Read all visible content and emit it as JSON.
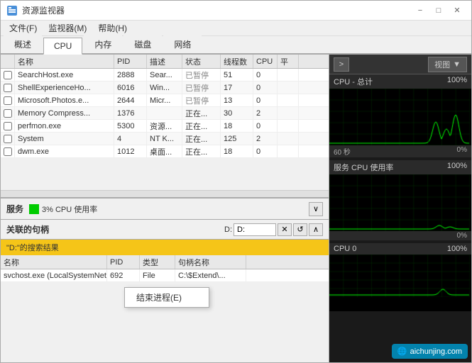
{
  "window": {
    "title": "资源监视器",
    "icon": "monitor-icon"
  },
  "menu": {
    "items": [
      "文件(F)",
      "监视器(M)",
      "帮助(H)"
    ]
  },
  "tabs": {
    "items": [
      "概述",
      "CPU",
      "内存",
      "磁盘",
      "网络"
    ],
    "active": "CPU"
  },
  "process_table": {
    "headers": [
      "名称",
      "PID",
      "描述",
      "状态",
      "线程数",
      "CPU",
      "平"
    ],
    "rows": [
      {
        "check": false,
        "name": "SearchHost.exe",
        "pid": "2888",
        "desc": "Sear...",
        "state": "已暂停",
        "threads": "51",
        "cpu": "0",
        "avg": ""
      },
      {
        "check": false,
        "name": "ShellExperienceHo...",
        "pid": "6016",
        "desc": "Win...",
        "state": "已暂停",
        "threads": "17",
        "cpu": "0",
        "avg": ""
      },
      {
        "check": false,
        "name": "Microsoft.Photos.e...",
        "pid": "2644",
        "desc": "Micr...",
        "state": "已暂停",
        "threads": "13",
        "cpu": "0",
        "avg": ""
      },
      {
        "check": false,
        "name": "Memory Compress...",
        "pid": "1376",
        "desc": "",
        "state": "正在...",
        "threads": "30",
        "cpu": "2",
        "avg": ""
      },
      {
        "check": false,
        "name": "perfmon.exe",
        "pid": "5300",
        "desc": "资源...",
        "state": "正在...",
        "threads": "18",
        "cpu": "0",
        "avg": ""
      },
      {
        "check": false,
        "name": "System",
        "pid": "4",
        "desc": "NT K...",
        "state": "正在...",
        "threads": "125",
        "cpu": "2",
        "avg": ""
      },
      {
        "check": false,
        "name": "dwm.exe",
        "pid": "1012",
        "desc": "桌面...",
        "state": "正在...",
        "threads": "18",
        "cpu": "0",
        "avg": ""
      }
    ]
  },
  "service_section": {
    "label": "服务",
    "cpu_pct": "3% CPU 使用率"
  },
  "handle_section": {
    "title": "关联的句柄",
    "search_label": "D:",
    "search_result": "\"D:\"的搜索结果",
    "headers": [
      "名称",
      "PID",
      "类型",
      "句柄名称"
    ],
    "rows": [
      {
        "name": "svchost.exe (LocalSystemNetw...",
        "pid": "692",
        "type": "File",
        "handle": "C:\\$Extend\\..."
      }
    ]
  },
  "context_menu": {
    "items": [
      "结束进程(E)"
    ]
  },
  "right_panel": {
    "nav_btn": ">",
    "view_label": "视图",
    "charts": [
      {
        "label": "CPU - 总计",
        "pct": "100%",
        "time": "60 秒",
        "val": "0%",
        "id": "chart0"
      },
      {
        "label": "服务 CPU 使用率",
        "pct": "100%",
        "time": "",
        "val": "0%",
        "id": "chart1"
      },
      {
        "label": "CPU 0",
        "pct": "100%",
        "time": "",
        "val": "",
        "id": "chart2"
      }
    ]
  }
}
